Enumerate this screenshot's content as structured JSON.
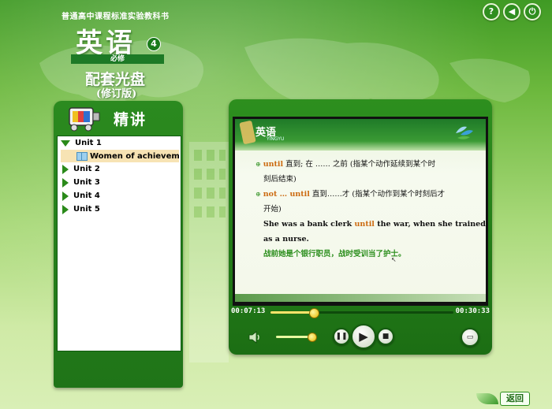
{
  "header": {
    "series_title": "普通高中课程标准实验教科书",
    "book_title": "英语",
    "volume": "4",
    "required_label": "必修",
    "disc_title": "配套光盘",
    "edition": "(修订版)"
  },
  "top_icons": [
    {
      "name": "help",
      "glyph": "?"
    },
    {
      "name": "sound",
      "glyph": "◀"
    },
    {
      "name": "exit",
      "glyph": "⏻"
    }
  ],
  "left_panel": {
    "title": "精讲",
    "units": [
      {
        "label": "Unit 1",
        "expanded": true,
        "lessons": [
          "Women of achievement"
        ]
      },
      {
        "label": "Unit 2",
        "expanded": false
      },
      {
        "label": "Unit 3",
        "expanded": false
      },
      {
        "label": "Unit 4",
        "expanded": false
      },
      {
        "label": "Unit 5",
        "expanded": false
      }
    ]
  },
  "slide": {
    "logo": "英语",
    "logo_sub": "YINGYU",
    "line1_kw": "until",
    "line1_text": " 直到; 在 …… 之前 (指某个动作延续到某个时",
    "line2_text": "刻后结束)",
    "line3_kw": "not … until",
    "line3_text": " 直到……才 (指某个动作到某个时刻后才",
    "line4_text": "开始)",
    "line5_pre": "She was a bank clerk ",
    "line5_kw": "until",
    "line5_post": " the war, when she trained",
    "line6_text": "as a nurse.",
    "line7_text": "战前她是个银行职员，战时受训当了护士。"
  },
  "player": {
    "current_time": "00:07:13",
    "total_time": "00:30:33",
    "progress": 0.236,
    "volume": 0.9
  },
  "footer": {
    "back_label": "返回"
  },
  "colors": {
    "primary_green": "#2d8f1e",
    "highlight_orange": "#cc6a10",
    "selected_item_bg": "#f7e3b4"
  }
}
